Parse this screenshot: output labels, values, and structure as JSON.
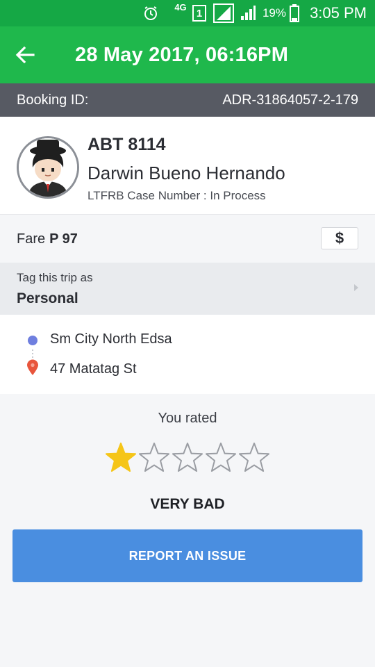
{
  "status_bar": {
    "network": "4G",
    "sim": "1",
    "battery": "19%",
    "time": "3:05 PM"
  },
  "header": {
    "title": "28 May 2017, 06:16PM"
  },
  "booking": {
    "label": "Booking ID:",
    "value": "ADR-31864057-2-179"
  },
  "driver": {
    "plate": "ABT 8114",
    "name": "Darwin Bueno Hernando",
    "case_number": "LTFRB Case Number : In Process"
  },
  "fare": {
    "label": "Fare",
    "amount": "P 97",
    "button_symbol": "$"
  },
  "tag": {
    "label": "Tag this trip as",
    "value": "Personal"
  },
  "route": {
    "pickup": "Sm City North Edsa",
    "dropoff": "47 Matatag St"
  },
  "rating": {
    "label": "You rated",
    "stars_filled": 1,
    "stars_total": 5,
    "text": "VERY BAD"
  },
  "actions": {
    "report_label": "REPORT AN ISSUE"
  },
  "colors": {
    "status_bar": "#15a845",
    "header": "#1fb84c",
    "booking_bar": "#575a63",
    "star_filled": "#f5c518",
    "pickup_dot": "#6f7fdf",
    "dropoff_pin": "#e8553c",
    "report_button": "#4a8ee0"
  }
}
